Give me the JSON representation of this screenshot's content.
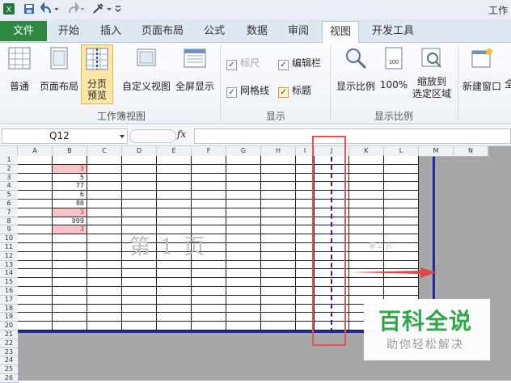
{
  "qat": {
    "window_title": "工作"
  },
  "tabs": {
    "file": "文件",
    "items": [
      "开始",
      "插入",
      "页面布局",
      "公式",
      "数据",
      "审阅",
      "视图",
      "开发工具"
    ]
  },
  "ribbon": {
    "workbook_views": {
      "normal": "普通",
      "page_layout": "页面布局",
      "page_break_1": "分页",
      "page_break_2": "预览",
      "custom_views": "自定义视图",
      "full_screen": "全屏显示",
      "group_label": "工作簿视图"
    },
    "show": {
      "ruler": "标尺",
      "formula_bar": "编辑栏",
      "gridlines": "网格线",
      "headings": "标题",
      "group_label": "显示"
    },
    "zoom": {
      "zoom": "显示比例",
      "hundred": "100%",
      "zoom_sel_1": "缩放到",
      "zoom_sel_2": "选定区域",
      "group_label": "显示比例"
    },
    "window": {
      "new_window": "新建窗口",
      "arrange": "全"
    }
  },
  "formula_bar": {
    "name_box": "Q12",
    "fx": "fx",
    "formula": ""
  },
  "sheet": {
    "columns": [
      "A",
      "B",
      "C",
      "D",
      "E",
      "F",
      "G",
      "H",
      "I",
      "J",
      "K",
      "L",
      "M",
      "N"
    ],
    "rows": [
      "1",
      "2",
      "3",
      "4",
      "5",
      "6",
      "7",
      "8",
      "9",
      "10",
      "11",
      "12",
      "13",
      "14",
      "15",
      "16",
      "17",
      "18",
      "19",
      "20",
      "21",
      "22",
      "23",
      "24",
      "25",
      "26"
    ],
    "b_values": [
      "",
      "3",
      "5",
      "77",
      "6",
      "88",
      "3",
      "999",
      "3"
    ],
    "page1_watermark": "第 1 页",
    "page2_watermark": "第 2 页"
  },
  "watermark_logo": {
    "title": "百科全说",
    "subtitle": "助你轻松解决"
  }
}
